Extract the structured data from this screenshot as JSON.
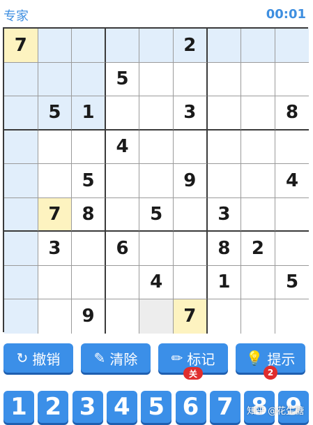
{
  "header": {
    "mode": "专家",
    "timer": "00:01"
  },
  "board": [
    [
      "7",
      "",
      "",
      "",
      "",
      "2",
      "",
      "",
      ""
    ],
    [
      "",
      "",
      "",
      "5",
      "",
      "",
      "",
      "",
      ""
    ],
    [
      "",
      "5",
      "1",
      "",
      "",
      "3",
      "",
      "",
      "8"
    ],
    [
      "",
      "",
      "",
      "4",
      "",
      "",
      "",
      "",
      ""
    ],
    [
      "",
      "",
      "5",
      "",
      "",
      "9",
      "",
      "",
      "4"
    ],
    [
      "",
      "7",
      "8",
      "",
      "5",
      "",
      "3",
      "",
      ""
    ],
    [
      "",
      "3",
      "",
      "6",
      "",
      "",
      "8",
      "2",
      ""
    ],
    [
      "",
      "",
      "",
      "",
      "4",
      "",
      "1",
      "",
      "5"
    ],
    [
      "",
      "",
      "9",
      "",
      "",
      "7",
      "",
      "",
      ""
    ]
  ],
  "highlights": {
    "row": 0,
    "col": 0,
    "same_number_cells": [
      [
        0,
        0
      ],
      [
        5,
        1
      ],
      [
        8,
        5
      ]
    ],
    "empty_focus_cell": [
      8,
      4
    ]
  },
  "toolbar": {
    "undo": {
      "label": "撤销",
      "icon": "undo-icon"
    },
    "erase": {
      "label": "清除",
      "icon": "eraser-icon"
    },
    "notes": {
      "label": "标记",
      "icon": "pencil-icon",
      "badge": "关"
    },
    "hint": {
      "label": "提示",
      "icon": "lightbulb-icon",
      "badge": "2"
    }
  },
  "numpad": [
    "1",
    "2",
    "3",
    "4",
    "5",
    "6",
    "7",
    "8",
    "9"
  ],
  "watermark": "知乎 @花生糖",
  "colors": {
    "accent": "#3b8fe8",
    "highlight": "#e1eefb",
    "selected": "#fdf3c0",
    "badge": "#e02d2d"
  }
}
